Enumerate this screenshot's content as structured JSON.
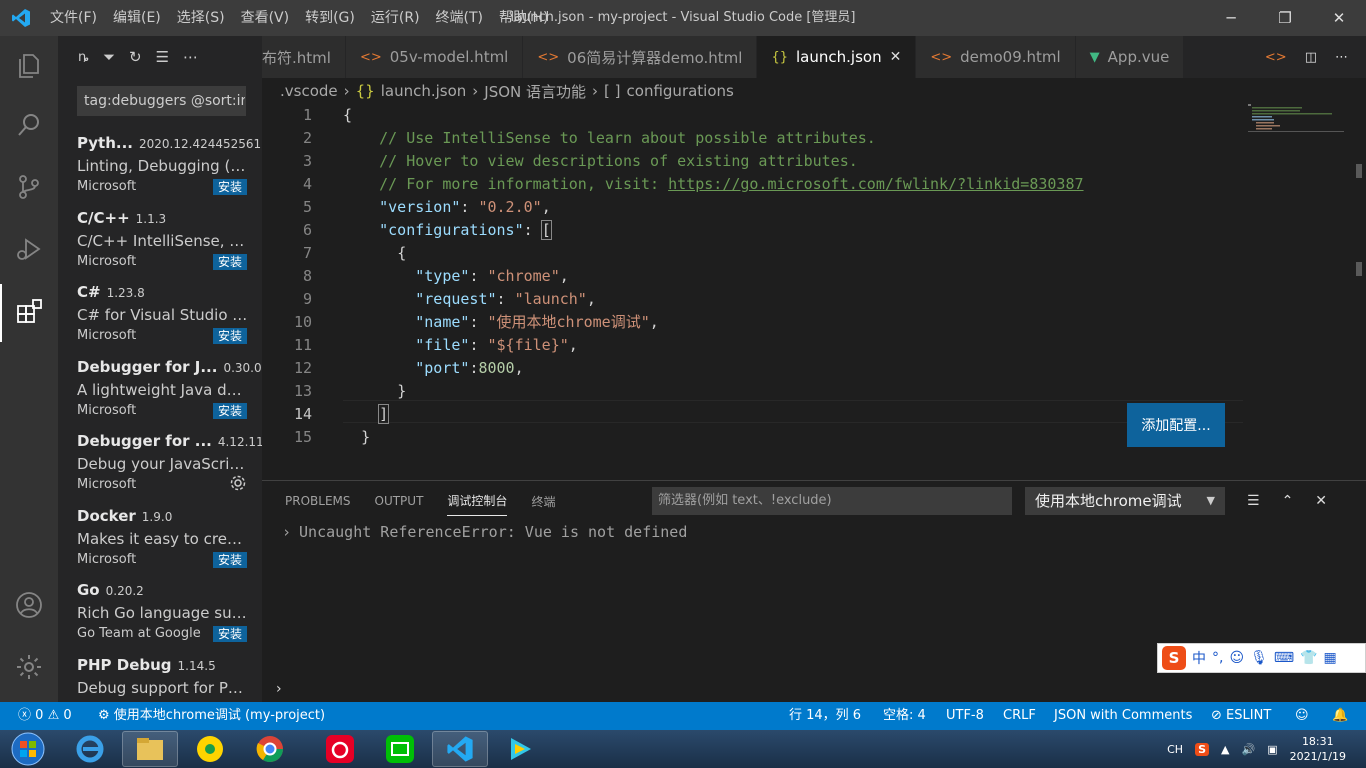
{
  "titlebar": {
    "menu": [
      "文件(F)",
      "编辑(E)",
      "选择(S)",
      "查看(V)",
      "转到(G)",
      "运行(R)",
      "终端(T)",
      "帮助(H)"
    ],
    "title": "launch.json - my-project - Visual Studio Code [管理员]"
  },
  "sidebar": {
    "search": "tag:debuggers @sort:ins",
    "extensions": [
      {
        "name": "Pyth...",
        "version": "2020.12.424452561",
        "desc": "Linting, Debugging (m...",
        "publisher": "Microsoft",
        "action": "安装"
      },
      {
        "name": "C/C++",
        "version": "1.1.3",
        "desc": "C/C++ IntelliSense, de...",
        "publisher": "Microsoft",
        "action": "安装"
      },
      {
        "name": "C#",
        "version": "1.23.8",
        "desc": "C# for Visual Studio Co...",
        "publisher": "Microsoft",
        "action": "安装"
      },
      {
        "name": "Debugger for J...",
        "version": "0.30.0",
        "desc": "A lightweight Java deb...",
        "publisher": "Microsoft",
        "action": "安装"
      },
      {
        "name": "Debugger for ...",
        "version": "4.12.11",
        "desc": "Debug your JavaScript ...",
        "publisher": "Microsoft",
        "action": ""
      },
      {
        "name": "Docker",
        "version": "1.9.0",
        "desc": "Makes it easy to create...",
        "publisher": "Microsoft",
        "action": "安装"
      },
      {
        "name": "Go",
        "version": "0.20.2",
        "desc": "Rich Go language supp...",
        "publisher": "Go Team at Google",
        "action": "安装"
      },
      {
        "name": "PHP Debug",
        "version": "1.14.5",
        "desc": "Debug support for PH...",
        "publisher": "",
        "action": ""
      }
    ]
  },
  "tabs": [
    {
      "label": "布符.html",
      "icon": "<>",
      "kind": "html"
    },
    {
      "label": "05v-model.html",
      "icon": "<>",
      "kind": "html"
    },
    {
      "label": "06简易计算器demo.html",
      "icon": "<>",
      "kind": "html"
    },
    {
      "label": "launch.json",
      "icon": "{}",
      "kind": "json",
      "active": true
    },
    {
      "label": "demo09.html",
      "icon": "<>",
      "kind": "html"
    },
    {
      "label": "App.vue",
      "icon": "▼",
      "kind": "vue"
    }
  ],
  "breadcrumb": {
    "folder": ".vscode",
    "file": "launch.json",
    "section": "JSON 语言功能",
    "node_icon": "[ ]",
    "node": "configurations"
  },
  "editor": {
    "comment1": "// Use IntelliSense to learn about possible attributes.",
    "comment2": "// Hover to view descriptions of existing attributes.",
    "comment3": "// For more information, visit: ",
    "url": "https://go.microsoft.com/fwlink/?linkid=830387",
    "version_key": "\"version\"",
    "version_val": "\"0.2.0\"",
    "configurations_key": "\"configurations\"",
    "type_key": "\"type\"",
    "type_val": "\"chrome\"",
    "request_key": "\"request\"",
    "request_val": "\"launch\"",
    "name_key": "\"name\"",
    "name_val": "\"使用本地chrome调试\"",
    "file_key": "\"file\"",
    "file_val": "\"${file}\"",
    "port_key": "\"port\"",
    "port_val": "8000",
    "add_config": "添加配置..."
  },
  "panel": {
    "tabs": [
      "PROBLEMS",
      "OUTPUT",
      "调试控制台",
      "终端"
    ],
    "filter_placeholder": "筛选器(例如 text、!exclude)",
    "config": "使用本地chrome调试",
    "output": "Uncaught ReferenceError: Vue is not defined",
    "ime_label": "中"
  },
  "statusbar": {
    "errors": "0",
    "warnings": "0",
    "debug": "使用本地chrome调试 (my-project)",
    "position": "行 14，列 6",
    "spaces": "空格: 4",
    "encoding": "UTF-8",
    "eol": "CRLF",
    "language": "JSON with Comments",
    "eslint": "ESLINT"
  },
  "taskbar": {
    "lang": "CH",
    "time": "18:31",
    "date": "2021/1/19"
  },
  "colors": {
    "accent": "#007acc",
    "button": "#0e639c",
    "key": "#9cdcfe",
    "string": "#ce9178",
    "comment": "#6a9955"
  }
}
